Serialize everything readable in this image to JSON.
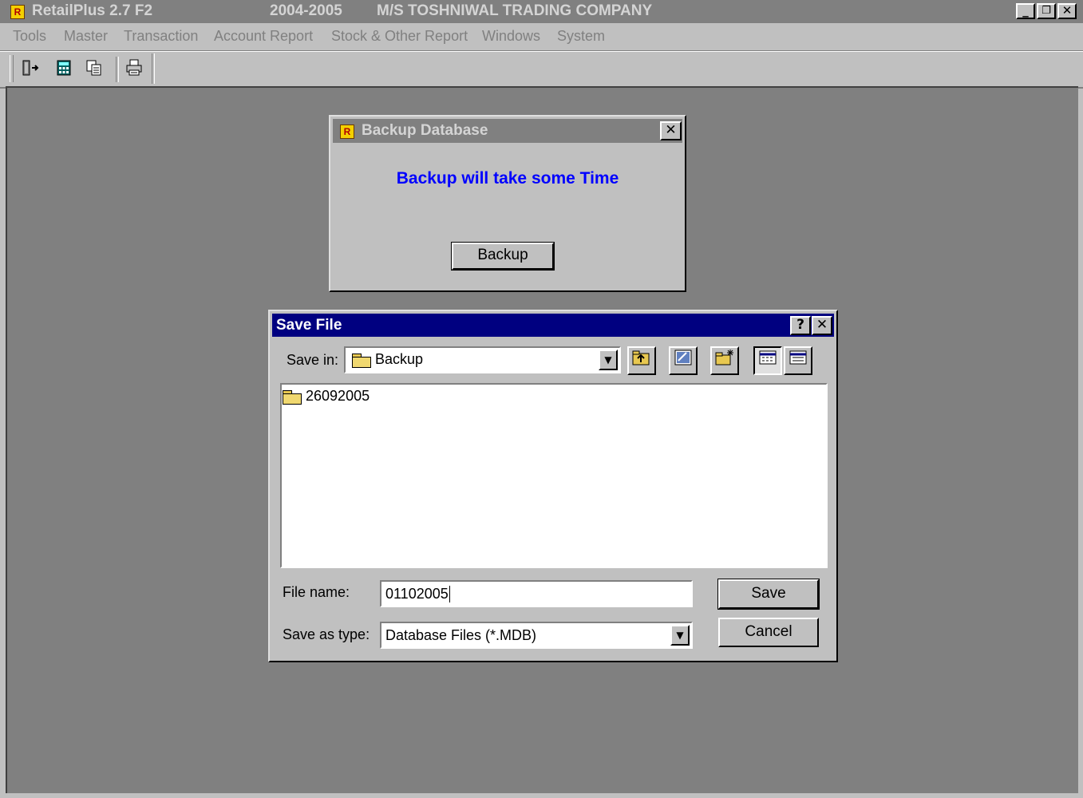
{
  "main_window": {
    "title_app": "RetailPlus 2.7 F2",
    "title_year": "2004-2005",
    "title_company": "M/S TOSHNIWAL TRADING COMPANY",
    "controls": {
      "minimize": "_",
      "restore": "❐",
      "close": "✕"
    }
  },
  "menu": {
    "items": [
      "Tools",
      "Master",
      "Transaction",
      "Account Report",
      "Stock & Other Report",
      "Windows",
      "System"
    ]
  },
  "toolbar": {
    "icons": [
      "exit-icon",
      "calculator-icon",
      "copy-icon",
      "print-icon"
    ]
  },
  "backup_window": {
    "title": "Backup Database",
    "message": "Backup will take some Time",
    "button": "Backup",
    "message_color": "#0000ff"
  },
  "save_dialog": {
    "title": "Save File",
    "help_btn": "?",
    "close_btn": "✕",
    "save_in_label": "Save in:",
    "save_in_value": "Backup",
    "files": [
      "26092005"
    ],
    "file_name_label": "File name:",
    "file_name_value": "01102005",
    "save_as_type_label": "Save as type:",
    "save_as_type_value": "Database Files (*.MDB)",
    "save_button": "Save",
    "cancel_button": "Cancel",
    "title_color": "#000080"
  }
}
